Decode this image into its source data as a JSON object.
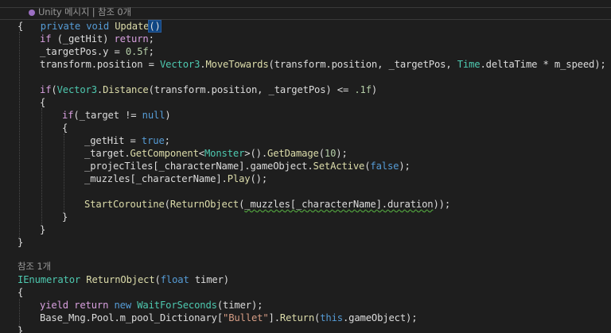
{
  "code": {
    "codelens_top": "Unity 메시지 | 참조 0개",
    "method_update": {
      "modifier": "private",
      "ret": "void",
      "name": "Update",
      "parens": "()"
    },
    "lines": {
      "open1": "{",
      "l1": "if (_getHit) return;",
      "l2": "_targetPos.y = 0.5f;",
      "l3a": "transform.position = ",
      "l3b": "Vector3",
      "l3c": ".",
      "l3d": "MoveTowards",
      "l3e": "(transform.position, _targetPos, ",
      "l3f": "Time",
      "l3g": ".deltaTime * m_speed);",
      "l4a": "if(",
      "l4b": "Vector3",
      "l4c": ".",
      "l4d": "Distance",
      "l4e": "(transform.position, _targetPos) <= ",
      "l4f": ".1f",
      "l4g": ")",
      "open2": "{",
      "l5a": "if",
      "l5b": "(_target != ",
      "l5c": "null",
      "l5d": ")",
      "open3": "{",
      "l6a": "_getHit = ",
      "l6b": "true",
      "l6c": ";",
      "l7a": "_target.",
      "l7b": "GetComponent",
      "l7c": "<",
      "l7d": "Monster",
      "l7e": ">().",
      "l7f": "GetDamage",
      "l7g": "(",
      "l7h": "10",
      "l7i": ");",
      "l8a": "_projecTiles[_characterName].gameObject.",
      "l8b": "SetActive",
      "l8c": "(",
      "l8d": "false",
      "l8e": ");",
      "l9a": "_muzzles[_characterName].",
      "l9b": "Play",
      "l9c": "();",
      "l10a": "StartCoroutine",
      "l10b": "(",
      "l10c": "ReturnObject",
      "l10d": "(",
      "l10e": "_muzzles[_characterName].duration",
      "l10f": "));",
      "close3": "}",
      "close2": "}",
      "close1": "}",
      "codelens_mid": "참조 1개",
      "m2a": "IEnumerator",
      "m2b": " ",
      "m2c": "ReturnObject",
      "m2d": "(",
      "m2e": "float",
      "m2f": " timer)",
      "open4": "{",
      "y1a": "yield return",
      "y1b": " ",
      "y1c": "new",
      "y1d": " ",
      "y1e": "WaitForSeconds",
      "y1f": "(timer);",
      "b1a": "Base_Mng.Pool.m_pool_Dictionary[",
      "b1b": "\"Bullet\"",
      "b1c": "].",
      "b1d": "Return",
      "b1e": "(",
      "b1f": "this",
      "b1g": ".gameObject);",
      "close4": "}"
    }
  }
}
